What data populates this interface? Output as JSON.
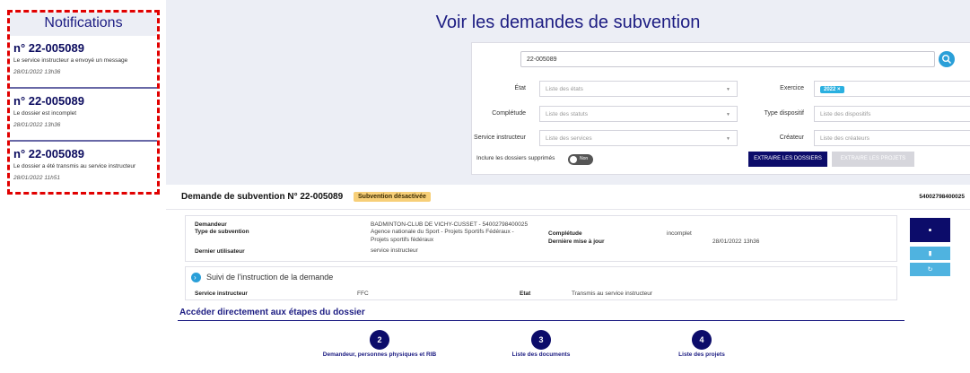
{
  "notifications": {
    "title": "Notifications",
    "items": [
      {
        "number": "n° 22-005089",
        "message": "Le service instructeur a envoyé un message",
        "date": "28/01/2022 13h36"
      },
      {
        "number": "n° 22-005089",
        "message": "Le dossier est incomplet",
        "date": "28/01/2022 13h36"
      },
      {
        "number": "n° 22-005089",
        "message": "Le dossier a été transmis au service instructeur",
        "date": "28/01/2022 11h51"
      }
    ]
  },
  "header": {
    "title": "Voir les demandes de subvention"
  },
  "search": {
    "value": "22-005089",
    "fields": {
      "etat": {
        "label": "État",
        "placeholder": "Liste des états"
      },
      "completude": {
        "label": "Complétude",
        "placeholder": "Liste des statuts"
      },
      "service": {
        "label": "Service instructeur",
        "placeholder": "Liste des services"
      },
      "exercice": {
        "label": "Exercice",
        "value": "2022"
      },
      "dispositif": {
        "label": "Type dispositif",
        "placeholder": "Liste des dispositifs"
      },
      "createur": {
        "label": "Créateur",
        "placeholder": "Liste des créateurs"
      }
    },
    "toggle_label": "Inclure les dossiers supprimés",
    "toggle_value": "Non",
    "extract_dossiers": "EXTRAIRE LES DOSSIERS",
    "extract_projets": "EXTRAIRE LES PROJETS"
  },
  "demande": {
    "title": "Demande de subvention N° 22-005089",
    "status_badge": "Subvention désactivée",
    "siret": "54002798400025",
    "info": {
      "demandeur_label": "Demandeur",
      "demandeur_value": "BADMINTON-CLUB DE VICHY-CUSSET - 54002798400025",
      "type_label": "Type de subvention",
      "type_value_1": "Agence nationale du Sport - Projets Sportifs Fédéraux -",
      "type_value_2": "Projets sportifs fédéraux",
      "utilisateur_label": "Dernier utilisateur",
      "utilisateur_value": "service instructeur",
      "completude_label": "Complétude",
      "completude_value": "incomplet",
      "maj_label": "Dernière mise à jour",
      "maj_value": "28/01/2022 13h36"
    },
    "suivi": {
      "title": "Suivi de l'instruction de la demande",
      "service_label": "Service instructeur",
      "service_value": "FFC",
      "etat_label": "Etat",
      "etat_value": "Transmis au service instructeur"
    }
  },
  "etapes": {
    "title": "Accéder directement aux étapes du dossier",
    "steps": [
      {
        "number": "2",
        "label": "Demandeur, personnes physiques et RIB"
      },
      {
        "number": "3",
        "label": "Liste des documents"
      },
      {
        "number": "4",
        "label": "Liste des projets"
      }
    ]
  },
  "colors": {
    "primary": "#0c0c6a",
    "accent": "#2a9fd8",
    "alert": "#e10000",
    "badge": "#f7cf78"
  },
  "icons": {
    "search": "search-icon",
    "eye": "eye-icon",
    "document": "document-icon",
    "refresh": "refresh-icon",
    "chevron": "chevron-right-icon"
  }
}
